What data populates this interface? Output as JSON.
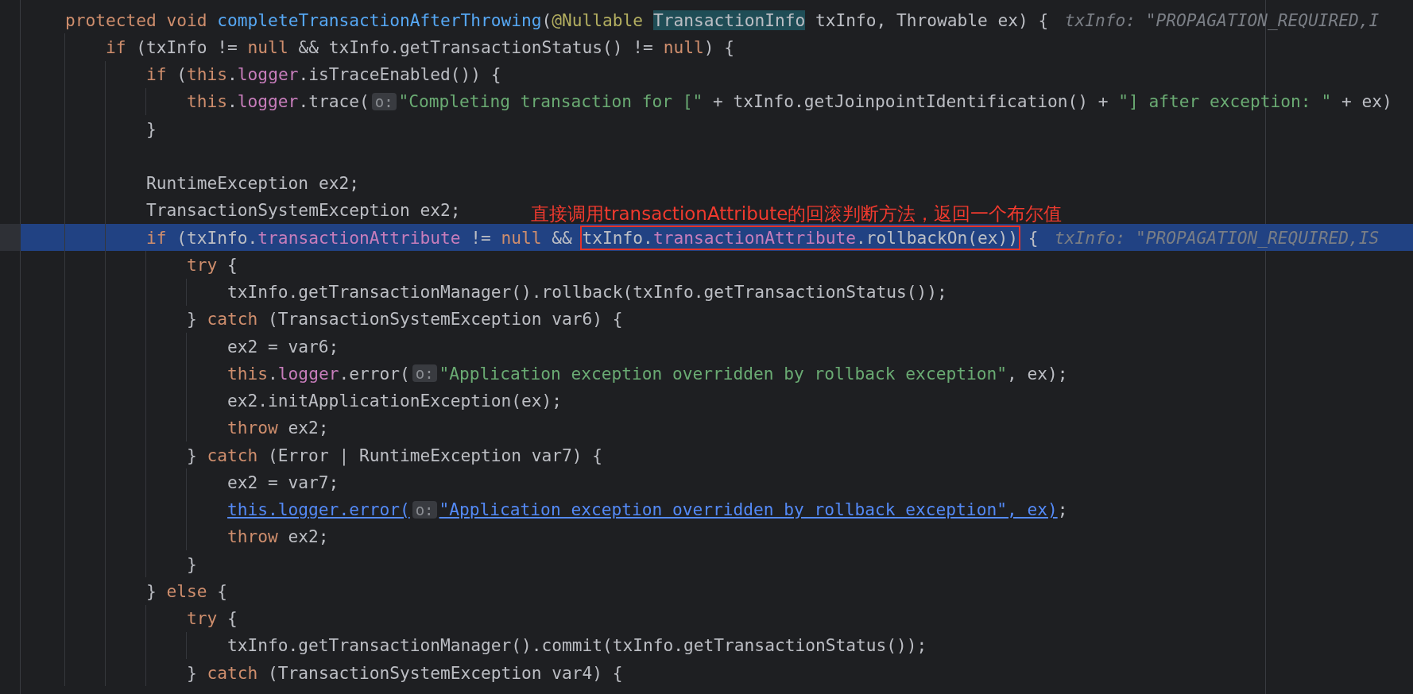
{
  "callout": {
    "text": "直接调用transactionAttribute的回滚判断方法，返回一个布尔值"
  },
  "lines": [
    {
      "current": false,
      "parts": [
        {
          "kind": "code",
          "tokens": [
            {
              "text": "protected void ",
              "kind": "keyword"
            },
            {
              "text": "completeTransactionAfterThrowing",
              "kind": "declaration"
            },
            {
              "text": "(",
              "kind": "plain"
            },
            {
              "text": "@Nullable",
              "kind": "annotation"
            }
          ]
        },
        {
          "kind": "symbol",
          "text": "TransactionInfo"
        },
        {
          "kind": "code",
          "tokens": [
            {
              "text": " txInfo, Throwable ex) {",
              "kind": "plain"
            }
          ]
        },
        {
          "kind": "inlay",
          "text": "txInfo: \"PROPAGATION_REQUIRED,I"
        }
      ],
      "children": [
        {
          "current": false,
          "parts": [
            {
              "kind": "code",
              "tokens": [
                {
                  "text": "if",
                  "kind": "keyword"
                },
                {
                  "text": " (txInfo != ",
                  "kind": "plain"
                },
                {
                  "text": "null",
                  "kind": "keyword"
                },
                {
                  "text": " && txInfo.getTransactionStatus() != ",
                  "kind": "plain"
                },
                {
                  "text": "null",
                  "kind": "keyword"
                },
                {
                  "text": ") {",
                  "kind": "plain"
                }
              ]
            }
          ],
          "children": [
            {
              "current": false,
              "parts": [
                {
                  "kind": "code",
                  "tokens": [
                    {
                      "text": "if",
                      "kind": "keyword"
                    },
                    {
                      "text": " (",
                      "kind": "plain"
                    },
                    {
                      "text": "this",
                      "kind": "keyword"
                    },
                    {
                      "text": ".",
                      "kind": "plain"
                    },
                    {
                      "text": "logger",
                      "kind": "field"
                    },
                    {
                      "text": ".isTraceEnabled()) {",
                      "kind": "plain"
                    }
                  ]
                }
              ],
              "children": [
                {
                  "current": false,
                  "parts": [
                    {
                      "kind": "code",
                      "tokens": [
                        {
                          "text": "this",
                          "kind": "keyword"
                        },
                        {
                          "text": ".",
                          "kind": "plain"
                        },
                        {
                          "text": "logger",
                          "kind": "field"
                        },
                        {
                          "text": ".trace(",
                          "kind": "plain"
                        }
                      ]
                    },
                    {
                      "kind": "hint",
                      "text": "o:"
                    },
                    {
                      "kind": "code",
                      "tokens": [
                        {
                          "text": "\"Completing transaction for [\"",
                          "kind": "string"
                        },
                        {
                          "text": " + txInfo.getJoinpointIdentification() + ",
                          "kind": "plain"
                        },
                        {
                          "text": "\"] after exception: \"",
                          "kind": "string"
                        },
                        {
                          "text": " + ex)",
                          "kind": "plain"
                        }
                      ]
                    }
                  ]
                }
              ]
            },
            {
              "current": false,
              "parts": [
                {
                  "kind": "code",
                  "tokens": [
                    {
                      "text": "}",
                      "kind": "plain"
                    }
                  ]
                }
              ]
            },
            {
              "current": false
            },
            {
              "current": false,
              "parts": [
                {
                  "kind": "code",
                  "tokens": [
                    {
                      "text": "RuntimeException ex2;",
                      "kind": "plain"
                    }
                  ]
                }
              ]
            },
            {
              "current": false,
              "parts": [
                {
                  "kind": "code",
                  "tokens": [
                    {
                      "text": "TransactionSystemException ex2;",
                      "kind": "plain"
                    }
                  ]
                }
              ]
            },
            {
              "current": true,
              "parts": [
                {
                  "kind": "code",
                  "tokens": [
                    {
                      "text": "if",
                      "kind": "keyword"
                    },
                    {
                      "text": " (txInfo.",
                      "kind": "plain"
                    },
                    {
                      "text": "transactionAttribute",
                      "kind": "field"
                    },
                    {
                      "text": " != ",
                      "kind": "plain"
                    },
                    {
                      "text": "null",
                      "kind": "keyword"
                    },
                    {
                      "text": " && ",
                      "kind": "plain"
                    }
                  ]
                },
                {
                  "kind": "framed",
                  "tokens": [
                    {
                      "text": "txInfo.",
                      "kind": "plain"
                    },
                    {
                      "text": "transactionAttribute",
                      "kind": "field"
                    },
                    {
                      "text": ".rollbackOn(ex))",
                      "kind": "plain"
                    }
                  ]
                },
                {
                  "kind": "code",
                  "tokens": [
                    {
                      "text": " {",
                      "kind": "plain"
                    }
                  ]
                },
                {
                  "kind": "inlay",
                  "text": "txInfo: \"PROPAGATION_REQUIRED,IS"
                }
              ],
              "children": [
                {
                  "current": false,
                  "parts": [
                    {
                      "kind": "code",
                      "tokens": [
                        {
                          "text": "try",
                          "kind": "keyword"
                        },
                        {
                          "text": " {",
                          "kind": "plain"
                        }
                      ]
                    }
                  ],
                  "children": [
                    {
                      "current": false,
                      "parts": [
                        {
                          "kind": "code",
                          "tokens": [
                            {
                              "text": "txInfo.getTransactionManager().rollback(txInfo.getTransactionStatus());",
                              "kind": "plain"
                            }
                          ]
                        }
                      ]
                    }
                  ]
                },
                {
                  "current": false,
                  "parts": [
                    {
                      "kind": "code",
                      "tokens": [
                        {
                          "text": "} ",
                          "kind": "plain"
                        },
                        {
                          "text": "catch",
                          "kind": "keyword"
                        },
                        {
                          "text": " (TransactionSystemException var6) {",
                          "kind": "plain"
                        }
                      ]
                    }
                  ],
                  "children": [
                    {
                      "current": false,
                      "parts": [
                        {
                          "kind": "code",
                          "tokens": [
                            {
                              "text": "ex2 = var6;",
                              "kind": "plain"
                            }
                          ]
                        }
                      ]
                    },
                    {
                      "current": false,
                      "parts": [
                        {
                          "kind": "code",
                          "tokens": [
                            {
                              "text": "this",
                              "kind": "keyword"
                            },
                            {
                              "text": ".",
                              "kind": "plain"
                            },
                            {
                              "text": "logger",
                              "kind": "field"
                            },
                            {
                              "text": ".error(",
                              "kind": "plain"
                            }
                          ]
                        },
                        {
                          "kind": "hint",
                          "text": "o:"
                        },
                        {
                          "kind": "code",
                          "tokens": [
                            {
                              "text": "\"Application exception overridden by rollback exception\"",
                              "kind": "string"
                            },
                            {
                              "text": ", ex);",
                              "kind": "plain"
                            }
                          ]
                        }
                      ]
                    },
                    {
                      "current": false,
                      "parts": [
                        {
                          "kind": "code",
                          "tokens": [
                            {
                              "text": "ex2.initApplicationException(ex);",
                              "kind": "plain"
                            }
                          ]
                        }
                      ]
                    },
                    {
                      "current": false,
                      "parts": [
                        {
                          "kind": "code",
                          "tokens": [
                            {
                              "text": "throw",
                              "kind": "keyword"
                            },
                            {
                              "text": " ex2;",
                              "kind": "plain"
                            }
                          ]
                        }
                      ]
                    }
                  ]
                },
                {
                  "current": false,
                  "parts": [
                    {
                      "kind": "code",
                      "tokens": [
                        {
                          "text": "} ",
                          "kind": "plain"
                        },
                        {
                          "text": "catch",
                          "kind": "keyword"
                        },
                        {
                          "text": " (Error | RuntimeException var7) {",
                          "kind": "plain"
                        }
                      ]
                    }
                  ],
                  "children": [
                    {
                      "current": false,
                      "parts": [
                        {
                          "kind": "code",
                          "tokens": [
                            {
                              "text": "ex2 = var7;",
                              "kind": "plain"
                            }
                          ]
                        }
                      ]
                    },
                    {
                      "current": false,
                      "parts": [
                        {
                          "kind": "link",
                          "text": "this.logger.error("
                        },
                        {
                          "kind": "hint",
                          "text": "o:"
                        },
                        {
                          "kind": "link",
                          "text": "\"Application exception overridden by rollback exception\", ex)"
                        },
                        {
                          "kind": "code",
                          "tokens": [
                            {
                              "text": ";",
                              "kind": "plain"
                            }
                          ]
                        }
                      ]
                    },
                    {
                      "current": false,
                      "parts": [
                        {
                          "kind": "code",
                          "tokens": [
                            {
                              "text": "throw",
                              "kind": "keyword"
                            },
                            {
                              "text": " ex2;",
                              "kind": "plain"
                            }
                          ]
                        }
                      ]
                    }
                  ]
                },
                {
                  "current": false,
                  "parts": [
                    {
                      "kind": "code",
                      "tokens": [
                        {
                          "text": "}",
                          "kind": "plain"
                        }
                      ]
                    }
                  ]
                }
              ]
            },
            {
              "current": false,
              "parts": [
                {
                  "kind": "code",
                  "tokens": [
                    {
                      "text": "} ",
                      "kind": "plain"
                    },
                    {
                      "text": "else",
                      "kind": "keyword"
                    },
                    {
                      "text": " {",
                      "kind": "plain"
                    }
                  ]
                }
              ],
              "children": [
                {
                  "current": false,
                  "parts": [
                    {
                      "kind": "code",
                      "tokens": [
                        {
                          "text": "try",
                          "kind": "keyword"
                        },
                        {
                          "text": " {",
                          "kind": "plain"
                        }
                      ]
                    }
                  ],
                  "children": [
                    {
                      "current": false,
                      "parts": [
                        {
                          "kind": "code",
                          "tokens": [
                            {
                              "text": "txInfo.getTransactionManager().commit(txInfo.getTransactionStatus());",
                              "kind": "plain"
                            }
                          ]
                        }
                      ]
                    }
                  ]
                },
                {
                  "current": false,
                  "parts": [
                    {
                      "kind": "code",
                      "tokens": [
                        {
                          "text": "} ",
                          "kind": "plain"
                        },
                        {
                          "text": "catch",
                          "kind": "keyword"
                        },
                        {
                          "text": " (TransactionSystemException var4) {",
                          "kind": "plain"
                        }
                      ]
                    }
                  ]
                }
              ]
            }
          ]
        }
      ]
    }
  ]
}
